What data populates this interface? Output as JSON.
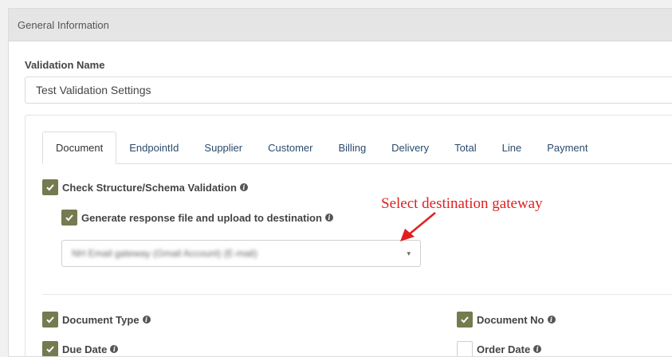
{
  "panel": {
    "title": "General Information"
  },
  "validation_name": {
    "label": "Validation Name",
    "value": "Test Validation Settings"
  },
  "tabs": [
    {
      "label": "Document",
      "active": true
    },
    {
      "label": "EndpointId",
      "active": false
    },
    {
      "label": "Supplier",
      "active": false
    },
    {
      "label": "Customer",
      "active": false
    },
    {
      "label": "Billing",
      "active": false
    },
    {
      "label": "Delivery",
      "active": false
    },
    {
      "label": "Total",
      "active": false
    },
    {
      "label": "Line",
      "active": false
    },
    {
      "label": "Payment",
      "active": false
    }
  ],
  "options": {
    "check_structure": {
      "label": "Check Structure/Schema Validation",
      "checked": true
    },
    "generate_response": {
      "label": "Generate response file and upload to destination",
      "checked": true
    },
    "gateway_select": {
      "value": "NH Email gateway (Gmail Account) (E-mail)",
      "arrow": "▾"
    }
  },
  "fields": {
    "document_type": {
      "label": "Document Type",
      "checked": true
    },
    "document_no": {
      "label": "Document No",
      "checked": true
    },
    "due_date": {
      "label": "Due Date",
      "checked": true
    },
    "order_date": {
      "label": "Order Date",
      "checked": false
    }
  },
  "annotation": {
    "text": "Select destination gateway",
    "color": "#e02020"
  },
  "colors": {
    "checkbox_checked": "#767a4f",
    "tab_text": "#2b4a6b",
    "header_bg": "#e5e5e5"
  }
}
